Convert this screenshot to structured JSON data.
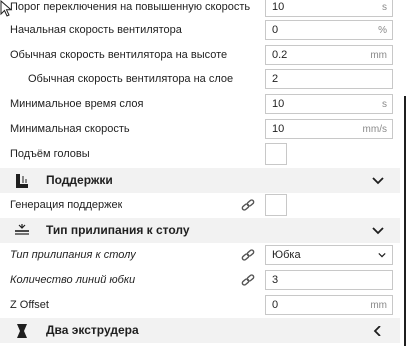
{
  "rows": [
    {
      "label": "Порог переключения на повышенную скорость",
      "value": "10",
      "unit": "s"
    },
    {
      "label": "Начальная скорость вентилятора",
      "value": "0",
      "unit": "%"
    },
    {
      "label": "Обычная скорость вентилятора на высоте",
      "value": "0.2",
      "unit": "mm"
    },
    {
      "label": "Обычная скорость вентилятора на слое",
      "value": "2",
      "unit": ""
    },
    {
      "label": "Минимальное время слоя",
      "value": "10",
      "unit": "s"
    },
    {
      "label": "Минимальная скорость",
      "value": "10",
      "unit": "mm/s"
    },
    {
      "label": "Подъём головы",
      "value": "",
      "unit": ""
    }
  ],
  "support_section": {
    "title": "Поддержки"
  },
  "support_rows": [
    {
      "label": "Генерация поддержек"
    }
  ],
  "adhesion_section": {
    "title": "Тип прилипания к столу"
  },
  "adhesion_rows": [
    {
      "label": "Тип прилипания к столу",
      "value": "Юбка"
    },
    {
      "label": "Количество линий юбки",
      "value": "3"
    },
    {
      "label": "Z Offset",
      "value": "0",
      "unit": "mm"
    }
  ],
  "dual_section": {
    "title": "Два экструдера"
  },
  "colors": {
    "section_bg": "#f2f2f2",
    "field_border": "#c8c8c8",
    "unit_text": "#8a8a8a"
  },
  "icons": {
    "support": "support-icon",
    "adhesion": "adhesion-icon",
    "dual": "dual-extruder-icon",
    "link": "link-icon",
    "chevron_down": "chevron-down-icon",
    "chevron_left": "chevron-left-icon"
  }
}
